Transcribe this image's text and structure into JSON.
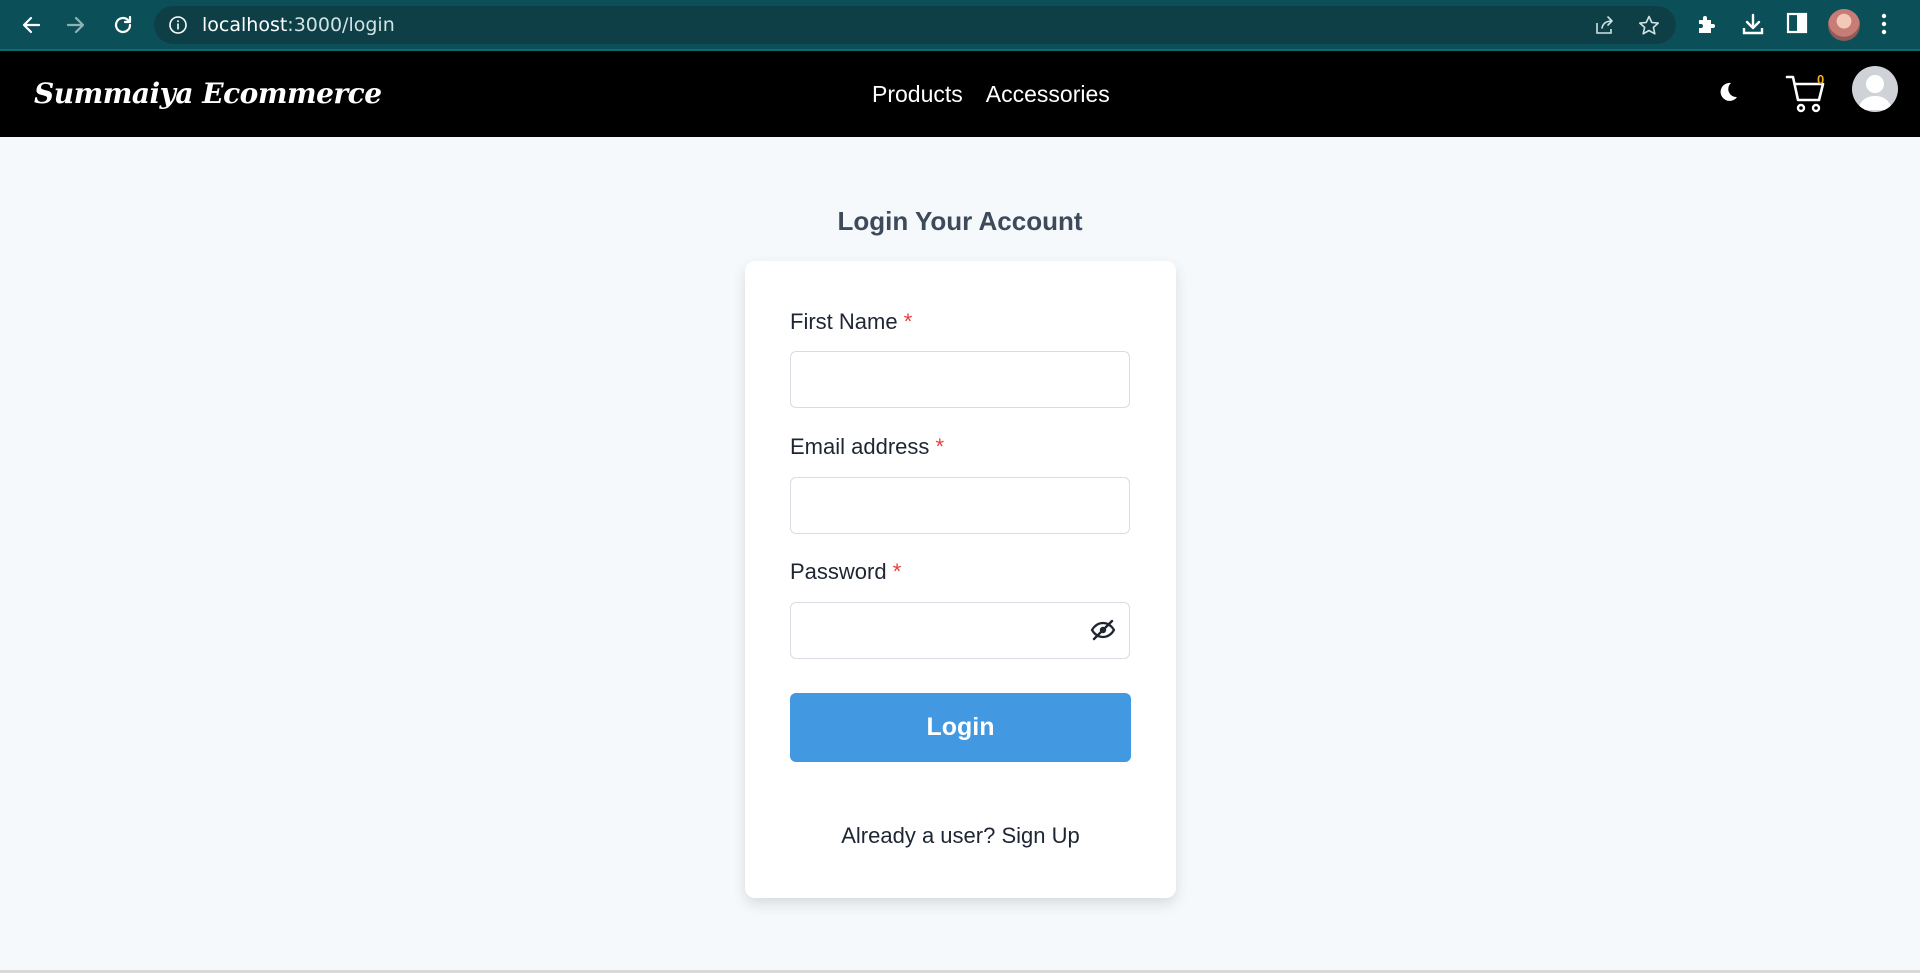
{
  "browser": {
    "url_host": "localhost",
    "url_path": ":3000/login"
  },
  "navbar": {
    "brand": "Summaiya Ecommerce",
    "links": [
      "Products",
      "Accessories"
    ],
    "cart_count": "0"
  },
  "login": {
    "title": "Login Your Account",
    "fields": [
      {
        "label": "First Name",
        "required_mark": "*",
        "value": ""
      },
      {
        "label": "Email address",
        "required_mark": "*",
        "value": ""
      },
      {
        "label": "Password",
        "required_mark": "*",
        "value": ""
      }
    ],
    "submit_label": "Login",
    "signup_prompt": "Already a user?",
    "signup_link": "Sign Up"
  },
  "colors": {
    "browser_bar": "#0b5059",
    "navbar": "#000000",
    "page_bg": "#f6f9fc",
    "primary_button": "#4299e1",
    "required": "#e53e3e",
    "cart_badge": "#f2b01e"
  },
  "icons": [
    "back-arrow-icon",
    "forward-arrow-icon",
    "reload-icon",
    "info-icon",
    "share-icon",
    "star-icon",
    "puzzle-icon",
    "download-icon",
    "side-panel-icon",
    "kebab-menu-icon",
    "moon-icon",
    "cart-icon",
    "user-icon",
    "eye-off-icon"
  ]
}
